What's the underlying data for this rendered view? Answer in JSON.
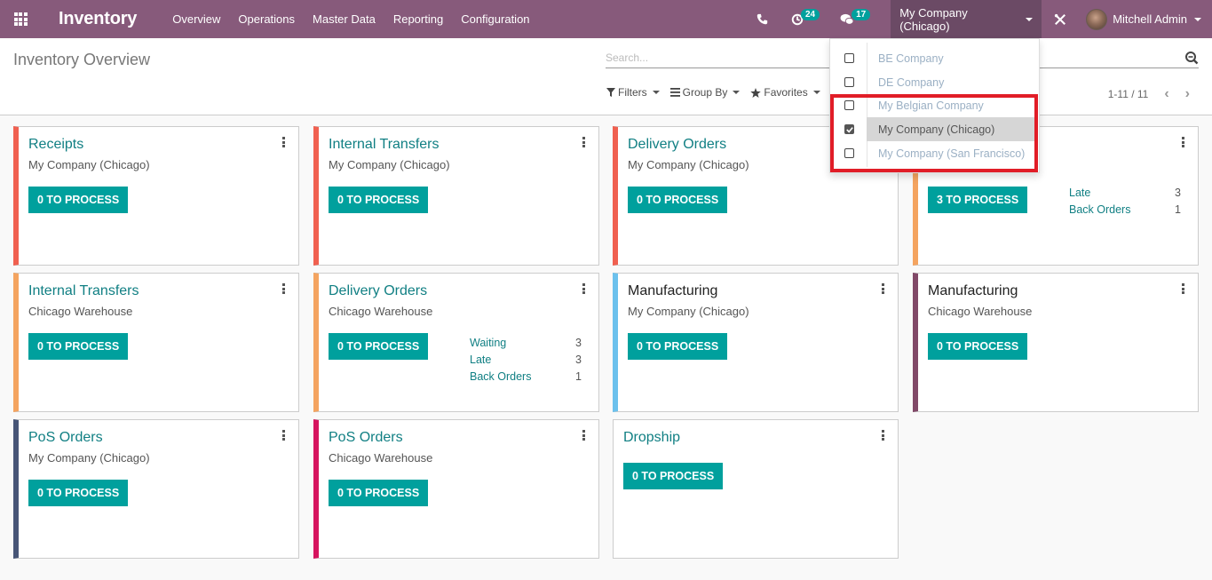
{
  "navbar": {
    "app_title": "Inventory",
    "menu": [
      "Overview",
      "Operations",
      "Master Data",
      "Reporting",
      "Configuration"
    ],
    "activity_count": "24",
    "messages_count": "17",
    "current_company": "My Company (Chicago)",
    "user_name": "Mitchell Admin",
    "colors": {
      "navbar": "#875a7b",
      "company_switch": "#6b4a65",
      "badge": "#00a09d"
    }
  },
  "control_panel": {
    "page_title": "Inventory Overview",
    "search_placeholder": "Search...",
    "filters_label": "Filters",
    "group_by_label": "Group By",
    "favorites_label": "Favorites",
    "pager_text": "1-11 / 11"
  },
  "company_dropdown": {
    "items": [
      {
        "label": "BE Company",
        "checked": false
      },
      {
        "label": "DE Company",
        "checked": false
      },
      {
        "label": "My Belgian Company",
        "checked": false
      },
      {
        "label": "My Company (Chicago)",
        "checked": true
      },
      {
        "label": "My Company (San Francisco)",
        "checked": false
      }
    ],
    "highlight_color": "#e11d27"
  },
  "cards": [
    {
      "title": "Receipts",
      "subtitle": "My Company (Chicago)",
      "button": "0 TO PROCESS",
      "color": "#f06050",
      "stats": []
    },
    {
      "title": "Internal Transfers",
      "subtitle": "My Company (Chicago)",
      "button": "0 TO PROCESS",
      "color": "#f06050",
      "stats": []
    },
    {
      "title": "Delivery Orders",
      "subtitle": "My Company (Chicago)",
      "button": "0 TO PROCESS",
      "color": "#f06050",
      "stats": []
    },
    {
      "title": "",
      "subtitle": "",
      "button": "3 TO PROCESS",
      "color": "#f4a460",
      "stats": [
        {
          "label": "Late",
          "value": "3"
        },
        {
          "label": "Back Orders",
          "value": "1"
        }
      ]
    },
    {
      "title": "Internal Transfers",
      "subtitle": "Chicago Warehouse",
      "button": "0 TO PROCESS",
      "color": "#f4a460",
      "stats": []
    },
    {
      "title": "Delivery Orders",
      "subtitle": "Chicago Warehouse",
      "button": "0 TO PROCESS",
      "color": "#f4a460",
      "stats": [
        {
          "label": "Waiting",
          "value": "3"
        },
        {
          "label": "Late",
          "value": "3"
        },
        {
          "label": "Back Orders",
          "value": "1"
        }
      ]
    },
    {
      "title": "Manufacturing",
      "subtitle": "My Company (Chicago)",
      "button": "0 TO PROCESS",
      "color": "#6cc1ed",
      "stats": []
    },
    {
      "title": "Manufacturing",
      "subtitle": "Chicago Warehouse",
      "button": "0 TO PROCESS",
      "color": "#814968",
      "stats": []
    },
    {
      "title": "PoS Orders",
      "subtitle": "My Company (Chicago)",
      "button": "0 TO PROCESS",
      "color": "#475577",
      "stats": []
    },
    {
      "title": "PoS Orders",
      "subtitle": "Chicago Warehouse",
      "button": "0 TO PROCESS",
      "color": "#d6145f",
      "stats": []
    },
    {
      "title": "Dropship",
      "subtitle": "",
      "button": "0 TO PROCESS",
      "color": "",
      "stats": []
    }
  ]
}
